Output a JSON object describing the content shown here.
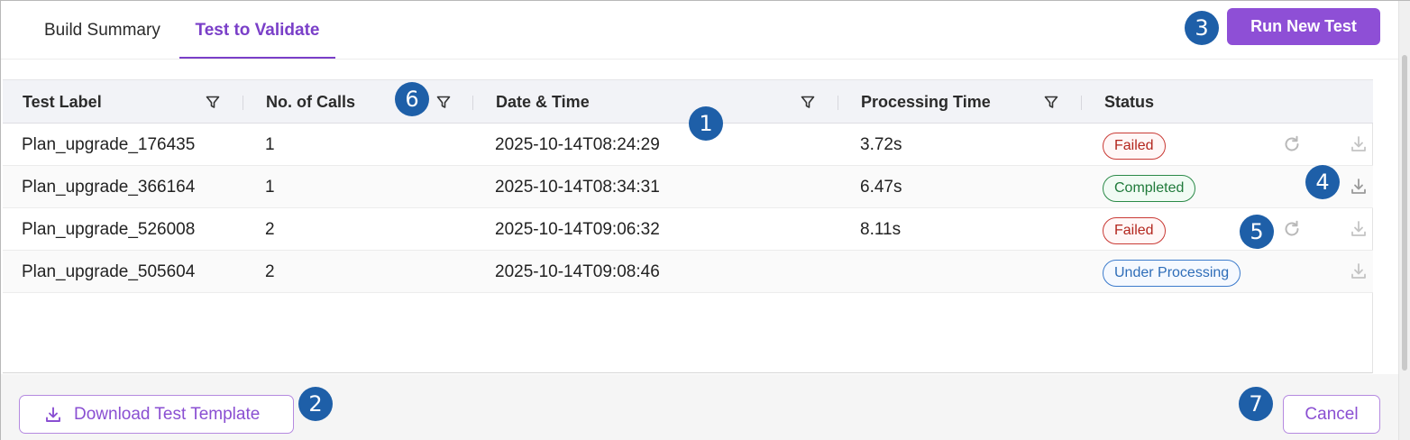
{
  "tabs": [
    {
      "label": "Build Summary",
      "active": false
    },
    {
      "label": "Test to Validate",
      "active": true
    }
  ],
  "actions": {
    "run_new_test": "Run New Test",
    "download_template": "Download Test Template",
    "cancel": "Cancel"
  },
  "table": {
    "columns": [
      "Test Label",
      "No. of Calls",
      "Date & Time",
      "Processing Time",
      "Status"
    ],
    "rows": [
      {
        "label": "Plan_upgrade_176435",
        "calls": "1",
        "datetime": "2025-10-14T08:24:29",
        "processing_time": "3.72s",
        "status": "Failed",
        "status_type": "failed"
      },
      {
        "label": "Plan_upgrade_366164",
        "calls": "1",
        "datetime": "2025-10-14T08:34:31",
        "processing_time": "6.47s",
        "status": "Completed",
        "status_type": "completed"
      },
      {
        "label": "Plan_upgrade_526008",
        "calls": "2",
        "datetime": "2025-10-14T09:06:32",
        "processing_time": "8.11s",
        "status": "Failed",
        "status_type": "failed"
      },
      {
        "label": "Plan_upgrade_505604",
        "calls": "2",
        "datetime": "2025-10-14T09:08:46",
        "processing_time": "",
        "status": "Under Processing",
        "status_type": "processing"
      }
    ]
  },
  "markers": [
    "1",
    "2",
    "3",
    "4",
    "5",
    "6",
    "7"
  ],
  "icons": {
    "filter": "filter-icon",
    "retry": "refresh-icon",
    "download": "download-icon"
  },
  "colors": {
    "accent": "#8e4fd6",
    "tab_active": "#7a3fc8",
    "marker": "#1e5fa8",
    "failed": "#b3261e",
    "completed": "#1f7a3a",
    "processing": "#2e6db8"
  }
}
